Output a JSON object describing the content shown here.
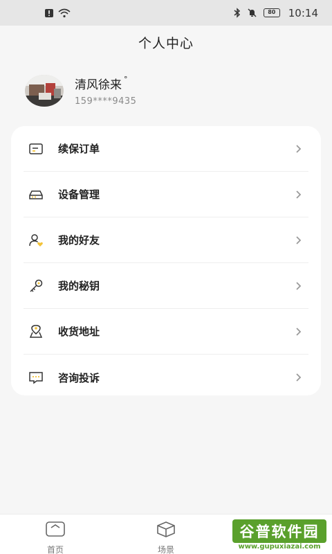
{
  "status_bar": {
    "time": "10:14",
    "battery": "80",
    "icons": [
      "alert-icon",
      "wifi-icon",
      "bluetooth-icon",
      "mute-icon",
      "battery-icon"
    ]
  },
  "header": {
    "title": "个人中心"
  },
  "profile": {
    "name": "清风徐来",
    "name_suffix": "°",
    "phone": "159****9435"
  },
  "menu": {
    "items": [
      {
        "label": "续保订单",
        "icon": "order-icon"
      },
      {
        "label": "设备管理",
        "icon": "device-icon"
      },
      {
        "label": "我的好友",
        "icon": "friends-icon"
      },
      {
        "label": "我的秘钥",
        "icon": "key-icon"
      },
      {
        "label": "收货地址",
        "icon": "address-icon"
      },
      {
        "label": "咨询投诉",
        "icon": "message-icon"
      }
    ]
  },
  "tabbar": {
    "items": [
      {
        "label": "首页",
        "icon": "home-icon"
      },
      {
        "label": "场景",
        "icon": "cube-icon"
      }
    ]
  },
  "watermark": {
    "brand": "谷普软件园",
    "url": "www.gupuxiazai.com"
  },
  "colors": {
    "accent": "#f3c33a",
    "background": "#f6f6f6",
    "card": "#ffffff",
    "watermark": "#5aa02c"
  }
}
